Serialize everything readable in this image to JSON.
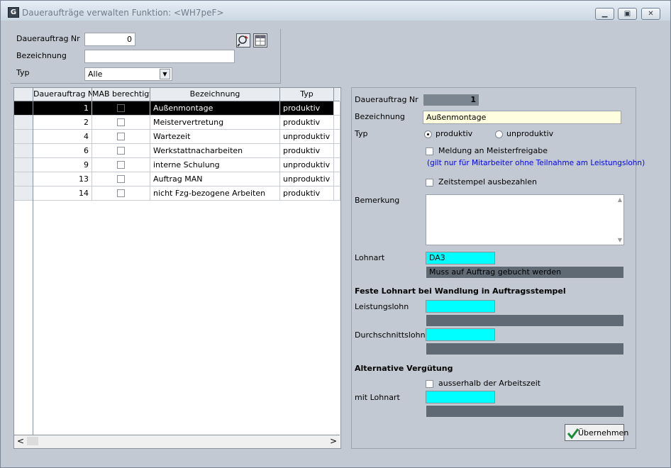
{
  "window": {
    "title": "Daueraufträge verwalten  Funktion: <WH7peF>",
    "app_icon_glyph": "G",
    "minimize_glyph": "▁",
    "maximize_glyph": "▣",
    "close_glyph": "✕"
  },
  "filter": {
    "nr_label": "Dauerauftrag Nr",
    "nr_value": "0",
    "bez_label": "Bezeichnung",
    "bez_value": "",
    "typ_label": "Typ",
    "typ_value": "Alle",
    "dropdown_glyph": "▼",
    "search_icon": "magnifier-icon",
    "grid_icon": "table-icon"
  },
  "table": {
    "columns": [
      "Dauerauftrag Nr",
      "MAB berechtigt",
      "Bezeichnung",
      "Typ"
    ],
    "rows": [
      {
        "nr": "1",
        "bez": "Außenmontage",
        "typ": "produktiv"
      },
      {
        "nr": "2",
        "bez": "Meistervertretung",
        "typ": "produktiv"
      },
      {
        "nr": "4",
        "bez": "Wartezeit",
        "typ": "unproduktiv"
      },
      {
        "nr": "6",
        "bez": "Werkstattnacharbeiten",
        "typ": "produktiv"
      },
      {
        "nr": "9",
        "bez": "interne Schulung",
        "typ": "unproduktiv"
      },
      {
        "nr": "13",
        "bez": "Auftrag MAN",
        "typ": "unproduktiv"
      },
      {
        "nr": "14",
        "bez": "nicht Fzg-bezogene Arbeiten",
        "typ": "produktiv"
      }
    ],
    "scroll_left_glyph": "<",
    "scroll_right_glyph": ">"
  },
  "detail": {
    "nr_label": "Dauerauftrag Nr",
    "nr_value": "1",
    "bez_label": "Bezeichnung",
    "bez_value": "Außenmontage",
    "typ_label": "Typ",
    "radio_produktiv": "produktiv",
    "radio_unproduktiv": "unproduktiv",
    "meldung_label": "Meldung an Meisterfreigabe",
    "meldung_note": "(gilt nur für Mitarbeiter ohne Teilnahme am Leistungslohn)",
    "zeitstempel_label": "Zeitstempel ausbezahlen",
    "bemerkung_label": "Bemerkung",
    "bemerkung_value": "",
    "lohnart_label": "Lohnart",
    "lohnart_value": "DA3",
    "lohnart_desc": "Muss auf Auftrag gebucht werden",
    "feste_header": "Feste Lohnart bei Wandlung in Auftragsstempel",
    "leistungslohn_label": "Leistungslohn",
    "leistungslohn_value": "",
    "leistungslohn_desc": "",
    "durchschnitt_label": "Durchschnittslohn",
    "durchschnitt_value": "",
    "durchschnitt_desc": "",
    "alt_header": "Alternative Vergütung",
    "ausserhalb_label": "ausserhalb der Arbeitszeit",
    "mitlohnart_label": "mit Lohnart",
    "mitlohnart_value": "",
    "mitlohnart_desc": "",
    "submit_label": "Übernehmen",
    "submit_icon": "checkmark-icon"
  },
  "colors": {
    "accent_cyan": "#00ffff",
    "slate": "#5f6a74",
    "note_blue": "#0000ff",
    "highlight_yellow": "#ffffe0"
  }
}
